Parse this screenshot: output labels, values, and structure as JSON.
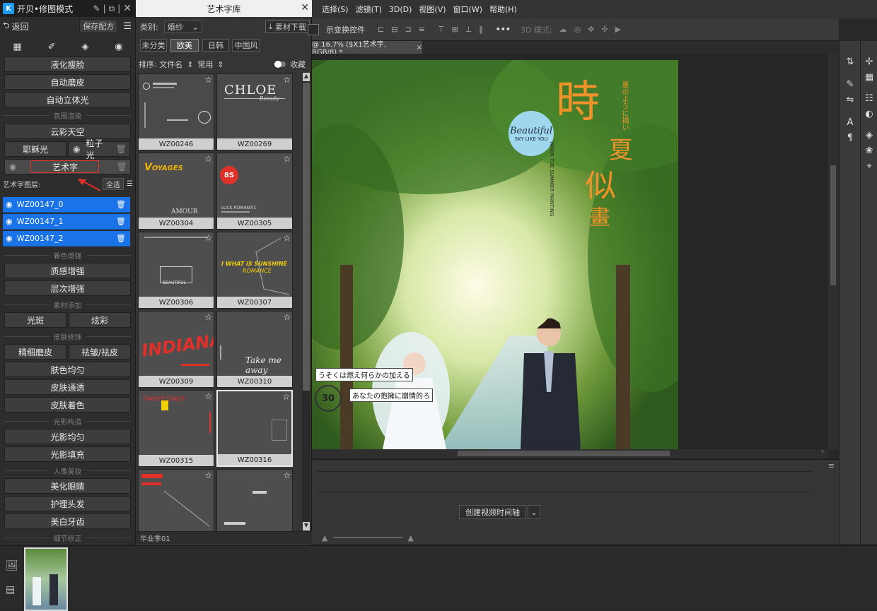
{
  "left_panel": {
    "title": "开贝•修图模式",
    "back_label": "返回",
    "save_preset_label": "保存配方",
    "buttons": {
      "liquify": "液化瘦脸",
      "auto_smooth": "自动磨皮",
      "auto_3d_light": "自动立体光",
      "cloud_sky": "云彩天空",
      "jesus_light": "耶稣光",
      "particle_light": "粒子光",
      "art_text": "艺术字",
      "texture": "质感增强",
      "layering": "层次增强",
      "spot": "光斑",
      "dazzle": "炫彩",
      "fine_smooth": "精细磨皮",
      "remove_wrinkle": "祛皱/祛皮",
      "skin_even": "肤色均匀",
      "skin_clear": "皮肤通透",
      "skin_tone": "皮肤着色",
      "light_even": "光影均匀",
      "light_fill": "光影填充",
      "eyes": "美化眼睛",
      "hair": "护理头发",
      "teeth": "美白牙齿"
    },
    "sections": {
      "atmosphere": "氛围渲染",
      "color": "着色增强",
      "material": "素材添加",
      "skin": "皮肤修饰",
      "light": "光影构造",
      "portrait": "人像美妆",
      "detail": "细节修正"
    },
    "art_layers_label": "艺术字图层:",
    "select_all_label": "全选",
    "layers": [
      "WZ00147_0",
      "WZ00147_1",
      "WZ00147_2"
    ]
  },
  "library": {
    "title": "艺术字库",
    "category_label": "类别:",
    "category_value": "婚纱",
    "download_label": "素材下载",
    "tags": [
      "未分类",
      "欧美",
      "日韩",
      "中国风"
    ],
    "active_tag": "欧美",
    "sort_label": "排序: 文件名",
    "sort_order": "常用",
    "favorites_label": "收藏",
    "items": [
      "WZ00246",
      "WZ00269",
      "WZ00304",
      "WZ00305",
      "WZ00306",
      "WZ00307",
      "WZ00309",
      "WZ00310",
      "WZ00315",
      "WZ00316",
      "",
      ""
    ],
    "footer_text": "毕业季01"
  },
  "ps": {
    "menu": [
      "选择(S)",
      "滤镜(T)",
      "3D(D)",
      "视图(V)",
      "窗口(W)",
      "帮助(H)"
    ],
    "options_label": "示变换控件",
    "mode_3d_label": "3D 模式:",
    "doc_tab": "@ 16.7% ($X1艺术字, RGB/8) *",
    "timeline_button": "创建视频时间轴"
  },
  "photo_text": {
    "main_title": "時",
    "sub_title_1": "夏",
    "sub_title_2": "似",
    "sub_title_3": "畫",
    "vertical_jp": "夏のように描い",
    "vertical_en": "WHEN THE SUMMER PAINTING",
    "badge_script": "Beautiful",
    "badge_line": "SKY LIKE YOU",
    "caption_1": "うそくは燃え何らかの加える",
    "caption_2": "あなたの抱擁に崩情的ろ",
    "round_num": "30"
  },
  "colors": {
    "accent_blue": "#1a73e8",
    "orange_title": "#f0922a",
    "badge_blue": "#9fd8ee"
  }
}
